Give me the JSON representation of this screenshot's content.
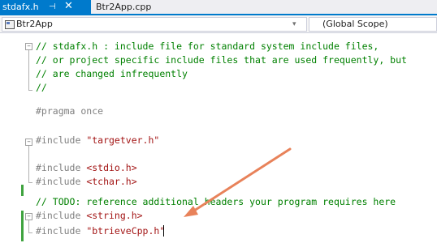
{
  "tabs": [
    {
      "title": "stdafx.h",
      "pin_icon": "pin-icon",
      "close_icon": "close-icon"
    },
    {
      "title": "Btr2App.cpp"
    }
  ],
  "nav": {
    "project": "Btr2App",
    "scope": "(Global Scope)",
    "dropdown_glyph": "▾"
  },
  "code": [
    "// stdafx.h : include file for standard system include files,",
    "// or project specific include files that are used frequently, but",
    "// are changed infrequently",
    "//",
    "",
    "#pragma once",
    "",
    "",
    "#include \"targetver.h\"",
    "",
    "#include <stdio.h>",
    "#include <tchar.h>",
    "",
    "// TODO: reference additional headers your program requires here",
    "#include <string.h>",
    "#include \"btrieveCpp.h\""
  ],
  "code_parts": {
    "l6": {
      "directive": "#pragma once"
    },
    "l9": {
      "directive": "#include",
      "arg": " \"targetver.h\""
    },
    "l11": {
      "directive": "#include",
      "arg": " <stdio.h>"
    },
    "l12": {
      "directive": "#include",
      "arg": " <tchar.h>"
    },
    "l15": {
      "directive": "#include",
      "arg": " <string.h>"
    },
    "l16": {
      "directive": "#include",
      "arg": " \"btrieveCpp.h\""
    }
  },
  "fold_glyph": "−",
  "colors": {
    "accent": "#007acc",
    "comment": "#008000",
    "preprocessor": "#808080",
    "string": "#a31515",
    "change_bar": "#3fa33f",
    "arrow": "#e8825a"
  }
}
